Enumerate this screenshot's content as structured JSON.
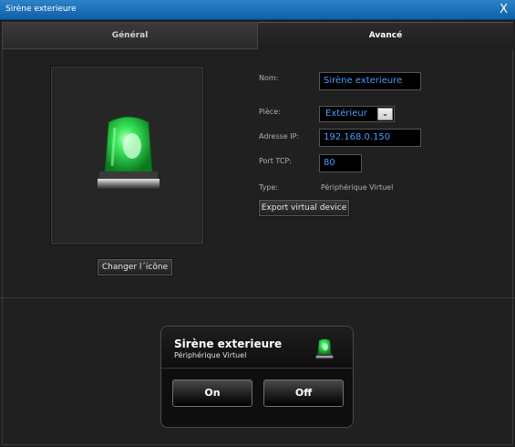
{
  "window": {
    "title": "Sirène exterieure",
    "close_label": "X"
  },
  "tabs": [
    {
      "label": "Général",
      "active": false
    },
    {
      "label": "Avancé",
      "active": true
    }
  ],
  "icon_panel": {
    "icon": "green-siren-icon",
    "change_button": "Changer l´icône"
  },
  "form": {
    "nom_label": "Nom:",
    "nom_value": "Sirène exterieure",
    "piece_label": "Pièce:",
    "piece_value": "Extérieur",
    "ip_label": "Adresse IP:",
    "ip_value": "192.168.0.150",
    "port_label": "Port TCP:",
    "port_value": "80",
    "type_label": "Type:",
    "type_value": "Périphérique Virtuel",
    "export_button": "Export virtual device"
  },
  "preview_card": {
    "title": "Sirène exterieure",
    "subtitle": "Périphérique Virtuel",
    "icon": "green-siren-icon",
    "on_label": "On",
    "off_label": "Off"
  },
  "colors": {
    "titlebar": "#1670b8",
    "field_text": "#4a9bff",
    "siren_green": "#2ee04a"
  }
}
